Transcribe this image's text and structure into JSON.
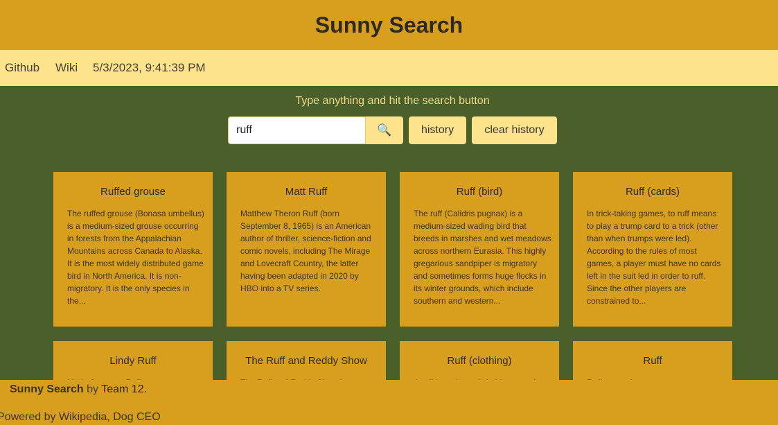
{
  "header": {
    "title": "Sunny Search"
  },
  "nav": {
    "github": "Github",
    "wiki": "Wiki",
    "datetime": "5/3/2023, 9:41:39 PM"
  },
  "search": {
    "prompt": "Type anything and hit the search button",
    "value": "ruff",
    "search_icon": "magnifying-glass-icon",
    "search_glyph": "🔍",
    "history_label": "history",
    "clear_history_label": "clear history"
  },
  "results": [
    {
      "title": "Ruffed grouse",
      "snippet": "The ruffed grouse (Bonasa umbellus) is a medium-sized grouse occurring in forests from the Appalachian Mountains across Canada to Alaska. It is the most widely distributed game bird in North America. It is non-migratory. It is the only species in the..."
    },
    {
      "title": "Matt Ruff",
      "snippet": "Matthew Theron Ruff (born September 8, 1965) is an American author of thriller, science-fiction and comic novels, including The Mirage and Lovecraft Country, the latter having been adapted in 2020 by HBO into a TV series."
    },
    {
      "title": "Ruff (bird)",
      "snippet": "The ruff (Calidris pugnax) is a medium-sized wading bird that breeds in marshes and wet meadows across northern Eurasia. This highly gregarious sandpiper is migratory and sometimes forms huge flocks in its winter grounds, which include southern and western..."
    },
    {
      "title": "Ruff (cards)",
      "snippet": "In trick-taking games, to ruff means to play a trump card to a trick (other than when trumps were led). According to the rules of most games, a player must have no cards left in the suit led in order to ruff. Since the other players are constrained to..."
    },
    {
      "title": "Lindy Ruff",
      "snippet": "Lindy Cameron Ruff..."
    },
    {
      "title": "The Ruff and Reddy Show",
      "snippet": "The Ruff and Reddy Show is..."
    },
    {
      "title": "Ruff (clothing)",
      "snippet": "A ruff is an item of clothing worn in..."
    },
    {
      "title": "Ruff",
      "snippet": "Ruff may refer to..."
    }
  ],
  "footer": {
    "brand": "Sunny Search",
    "by": "by",
    "team": "Team 12",
    "period": ".",
    "powered": "Powered by Wikipedia, Dog CEO"
  }
}
